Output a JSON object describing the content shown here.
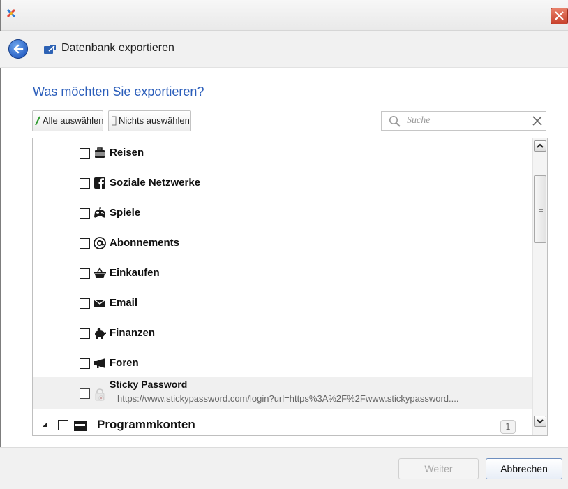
{
  "window": {
    "close_icon": "close-icon",
    "app_logo_icon": "app-logo-icon"
  },
  "nav": {
    "title": "Datenbank exportieren",
    "back_icon": "back-arrow-icon",
    "title_icon": "export-icon"
  },
  "heading": "Was möchten Sie exportieren?",
  "toolbar": {
    "select_all_label": "Alle auswählen",
    "select_none_label": "Nichts auswählen"
  },
  "search": {
    "placeholder": "Suche",
    "value": ""
  },
  "list": {
    "items": [
      {
        "label": "Reisen",
        "icon": "luggage-icon",
        "checked": false
      },
      {
        "label": "Soziale Netzwerke",
        "icon": "facebook-icon",
        "checked": false
      },
      {
        "label": "Spiele",
        "icon": "gamepad-icon",
        "checked": false
      },
      {
        "label": "Abonnements",
        "icon": "at-sign-icon",
        "checked": false
      },
      {
        "label": "Einkaufen",
        "icon": "basket-icon",
        "checked": false
      },
      {
        "label": "Email",
        "icon": "envelope-icon",
        "checked": false
      },
      {
        "label": "Finanzen",
        "icon": "piggy-bank-icon",
        "checked": false
      },
      {
        "label": "Foren",
        "icon": "megaphone-icon",
        "checked": false
      }
    ],
    "account": {
      "label": "Sticky Password",
      "url": "https://www.stickypassword.com/login?url=https%3A%2F%2Fwww.stickypassword....",
      "icon": "lock-icon",
      "checked": false
    },
    "group": {
      "label": "Programmkonten",
      "count": "1",
      "icon": "window-icon",
      "checked": false,
      "expanded": true
    }
  },
  "footer": {
    "next_label": "Weiter",
    "cancel_label": "Abbrechen"
  },
  "colors": {
    "heading": "#2a5dba",
    "selected_row": "#f0f0f0",
    "close_button": "#c8412c"
  }
}
